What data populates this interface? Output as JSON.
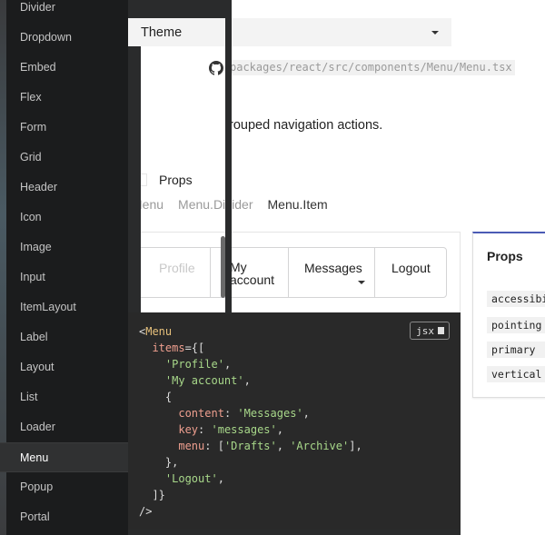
{
  "sidebar": {
    "items": [
      {
        "label": "Divider",
        "active": false
      },
      {
        "label": "Dropdown",
        "active": false
      },
      {
        "label": "Embed",
        "active": false
      },
      {
        "label": "Flex",
        "active": false
      },
      {
        "label": "Form",
        "active": false
      },
      {
        "label": "Grid",
        "active": false
      },
      {
        "label": "Header",
        "active": false
      },
      {
        "label": "Icon",
        "active": false
      },
      {
        "label": "Image",
        "active": false
      },
      {
        "label": "Input",
        "active": false
      },
      {
        "label": "ItemLayout",
        "active": false
      },
      {
        "label": "Label",
        "active": false
      },
      {
        "label": "Layout",
        "active": false
      },
      {
        "label": "List",
        "active": false
      },
      {
        "label": "Loader",
        "active": false
      },
      {
        "label": "Menu",
        "active": true
      },
      {
        "label": "Popup",
        "active": false
      },
      {
        "label": "Portal",
        "active": false
      }
    ]
  },
  "theme": {
    "label": "Theme"
  },
  "source": {
    "path": "packages/react/src/components/Menu/Menu.tsx",
    "icon": "github-icon"
  },
  "description": "rouped navigation actions.",
  "props_toggle": {
    "label": "Props"
  },
  "subtabs": [
    {
      "label": "Menu",
      "active": false
    },
    {
      "label": "Menu.Divider",
      "active": false
    },
    {
      "label": "Menu.Item",
      "active": true
    }
  ],
  "menu_preview": {
    "items": [
      {
        "label": "Profile",
        "disabled": true
      },
      {
        "label": "My account"
      },
      {
        "label": "Messages",
        "has_dropdown": true
      },
      {
        "label": "Logout"
      }
    ]
  },
  "code": {
    "badge": "jsx",
    "tag_open": "<",
    "tag": "Menu",
    "attr_items": "items",
    "open": "={[",
    "str_profile": "'Profile'",
    "str_account": "'My account'",
    "comma": ",",
    "brace_open": "{",
    "attr_content": "content",
    "colon": ": ",
    "str_messages": "'Messages'",
    "attr_key": "key",
    "str_key": "'messages'",
    "attr_menu": "menu",
    "arr_open": "[",
    "str_drafts": "'Drafts'",
    "str_archive": "'Archive'",
    "arr_close": "],",
    "brace_close": "},",
    "str_logout": "'Logout'",
    "close": "]}",
    "self_close": "/>"
  },
  "props_card": {
    "title": "Props",
    "items": [
      "accessibility",
      "pointing",
      "primary",
      "vertical"
    ]
  },
  "colors": {
    "sidebar_bg": "#1b1c1d",
    "code_bg": "#292929",
    "accent_props": "#4b5bb5",
    "code_tag": "#e6c07b",
    "code_attr": "#ef9f8f",
    "code_string": "#a8d88a"
  }
}
